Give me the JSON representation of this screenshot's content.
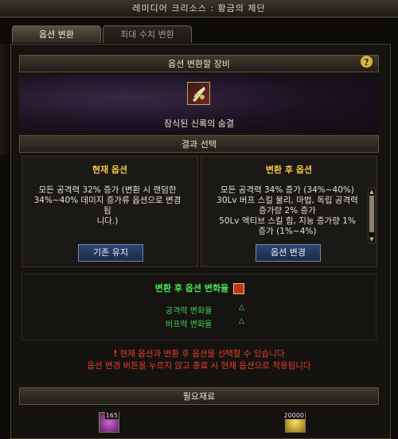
{
  "window": {
    "title": "레미디어 크리소스 : 황금의 제단"
  },
  "tabs": [
    {
      "label": "옵션 변환",
      "active": true
    },
    {
      "label": "최대 수치 변환",
      "active": false
    }
  ],
  "equipment_section": {
    "header": "옵션 변환할 장비",
    "item_name": "잠식된 신록의 숨결",
    "help_label": "?"
  },
  "result_section": {
    "header": "결과 선택",
    "current": {
      "title": "현재 옵션",
      "text": "모든 공격력 32% 증가 (변환 시 랜덤한\n34%~40% 데미지 증가류 옵션으로 변경됩\n니다.)",
      "button": "기존 유지"
    },
    "after": {
      "title": "변환 후 옵션",
      "text": "모든 공격력 34% 증가 (34%~40%)\n30Lv 버프 스킬 물리, 마법, 독립 공격력\n증가량 2% 증가\n50Lv 액티브 스킬 힘, 지능 증가량 1%\n증가 (1%~4%)",
      "button": "옵션 변경"
    }
  },
  "rate_section": {
    "title": "변환 후 옵션 변화율",
    "rows": [
      {
        "label": "공격력 변화율",
        "symbol": "△"
      },
      {
        "label": "버프력 변화율",
        "symbol": "△"
      }
    ]
  },
  "warning": {
    "icon": "!",
    "line1": "현재 옵션과 변환 후 옵션을 선택할 수 있습니다",
    "line2": "옵션 변경 버튼을 누르지 않고 종료 시 현재 옵션으로 적용됩니다"
  },
  "materials": {
    "header": "필요재료",
    "items": [
      {
        "count": "165",
        "icon": "purple-gem-icon"
      },
      {
        "count": "20000",
        "icon": "gold-coin-icon"
      }
    ]
  },
  "colors": {
    "accent_gold": "#f2c24a",
    "rate_green": "#47e55a",
    "warning_red": "#e83e2e",
    "button_blue": "#2e4670"
  }
}
